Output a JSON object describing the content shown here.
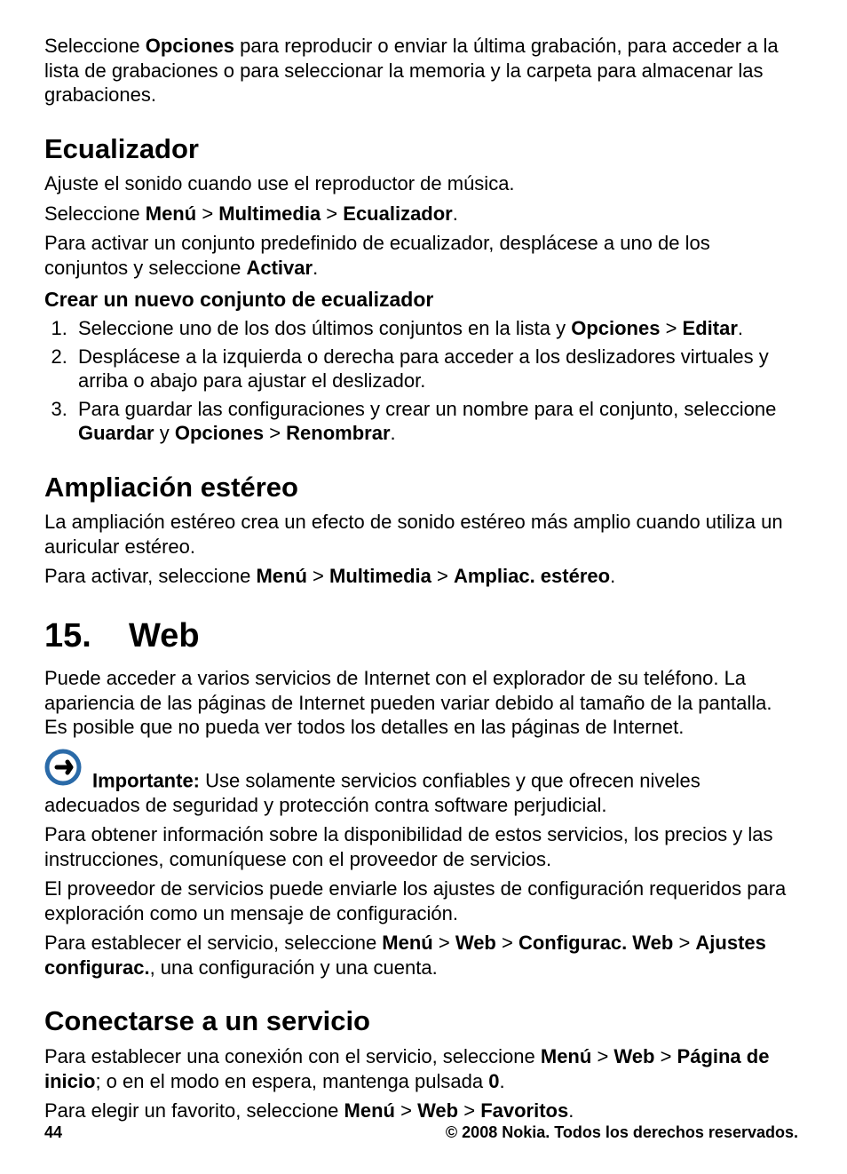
{
  "intro_p1_a": "Seleccione ",
  "intro_p1_b": "Opciones",
  "intro_p1_c": " para reproducir o enviar la última grabación, para acceder a la lista de grabaciones o para seleccionar la memoria y la carpeta para almacenar las grabaciones.",
  "h_equalizer": "Ecualizador",
  "eq_p1": "Ajuste el sonido cuando use el reproductor de música.",
  "eq_p2_a": "Seleccione ",
  "eq_p2_b": "Menú",
  "eq_p2_c": " > ",
  "eq_p2_d": "Multimedia",
  "eq_p2_e": " > ",
  "eq_p2_f": "Ecualizador",
  "eq_p2_g": ".",
  "eq_p3_a": "Para activar un conjunto predefinido de ecualizador, desplácese a uno de los conjuntos y seleccione ",
  "eq_p3_b": "Activar",
  "eq_p3_c": ".",
  "h_eq_new": "Crear un nuevo conjunto de ecualizador",
  "li1_a": "Seleccione uno de los dos últimos conjuntos en la lista y ",
  "li1_b": "Opciones",
  "li1_c": " > ",
  "li1_d": "Editar",
  "li1_e": ".",
  "li2": "Desplácese a la izquierda o derecha para acceder a los deslizadores virtuales y arriba o abajo para ajustar el deslizador.",
  "li3_a": "Para guardar las configuraciones y crear un nombre para el conjunto, seleccione ",
  "li3_b": "Guardar",
  "li3_c": " y ",
  "li3_d": "Opciones",
  "li3_e": " > ",
  "li3_f": "Renombrar",
  "li3_g": ".",
  "h_stereo": "Ampliación estéreo",
  "st_p1": "La ampliación estéreo crea un efecto de sonido estéreo más amplio cuando utiliza un auricular estéreo.",
  "st_p2_a": "Para activar, seleccione ",
  "st_p2_b": "Menú",
  "st_p2_c": " > ",
  "st_p2_d": "Multimedia",
  "st_p2_e": " > ",
  "st_p2_f": "Ampliac. estéreo",
  "st_p2_g": ".",
  "ch_num": "15.",
  "ch_title": "Web",
  "web_p1": "Puede acceder a varios servicios de Internet con el explorador de su teléfono. La apariencia de las páginas de Internet pueden variar debido al tamaño de la pantalla. Es posible que no pueda ver todos los detalles en las páginas de Internet.",
  "imp_label": "Importante: ",
  "imp_text": " Use solamente servicios confiables y que ofrecen niveles adecuados de seguridad y protección contra software perjudicial.",
  "web_p2": "Para obtener información sobre la disponibilidad de estos servicios, los precios y las instrucciones, comuníquese con el proveedor de servicios.",
  "web_p3": "El proveedor de servicios puede enviarle los ajustes de configuración requeridos para exploración como un mensaje de configuración.",
  "web_p4_a": "Para establecer el servicio, seleccione ",
  "web_p4_b": "Menú",
  "web_p4_c": " > ",
  "web_p4_d": "Web",
  "web_p4_e": " > ",
  "web_p4_f": "Configurac. Web",
  "web_p4_g": " > ",
  "web_p4_h": "Ajustes configurac.",
  "web_p4_i": ", una configuración y una cuenta.",
  "h_connect": "Conectarse a un servicio",
  "con_p1_a": "Para establecer una conexión con el servicio, seleccione ",
  "con_p1_b": "Menú",
  "con_p1_c": " > ",
  "con_p1_d": "Web",
  "con_p1_e": " > ",
  "con_p1_f": "Página de inicio",
  "con_p1_g": "; o en el modo en espera, mantenga pulsada ",
  "con_p1_h": "0",
  "con_p1_i": ".",
  "con_p2_a": "Para elegir un favorito, seleccione ",
  "con_p2_b": "Menú",
  "con_p2_c": " > ",
  "con_p2_d": "Web",
  "con_p2_e": " > ",
  "con_p2_f": "Favoritos",
  "con_p2_g": ".",
  "page_number": "44",
  "copyright": "© 2008 Nokia. Todos los derechos reservados."
}
